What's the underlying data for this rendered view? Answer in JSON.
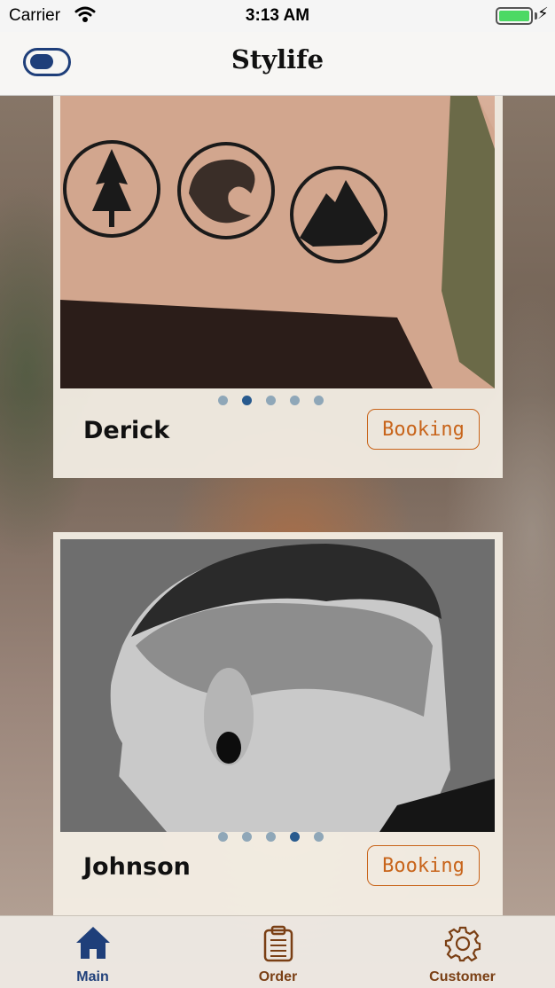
{
  "status_bar": {
    "carrier": "Carrier",
    "time": "3:13 AM",
    "battery_level": 1.0
  },
  "nav": {
    "title": "Stylife",
    "toggle_on": true
  },
  "cards": [
    {
      "name": "Derick",
      "booking_label": "Booking",
      "page_count": 5,
      "active_page": 1
    },
    {
      "name": "Johnson",
      "booking_label": "Booking",
      "page_count": 5,
      "active_page": 3
    }
  ],
  "tabs": [
    {
      "label": "Main",
      "icon": "home-icon",
      "selected": true
    },
    {
      "label": "Order",
      "icon": "clipboard-icon",
      "selected": false
    },
    {
      "label": "Customer",
      "icon": "gear-icon",
      "selected": false
    }
  ],
  "colors": {
    "accent_blue": "#1f3f7a",
    "booking_orange": "#c8641a",
    "tab_inactive": "#7a3f14",
    "dot_active": "#285a8e",
    "dot_inactive": "#8fa7b8"
  }
}
